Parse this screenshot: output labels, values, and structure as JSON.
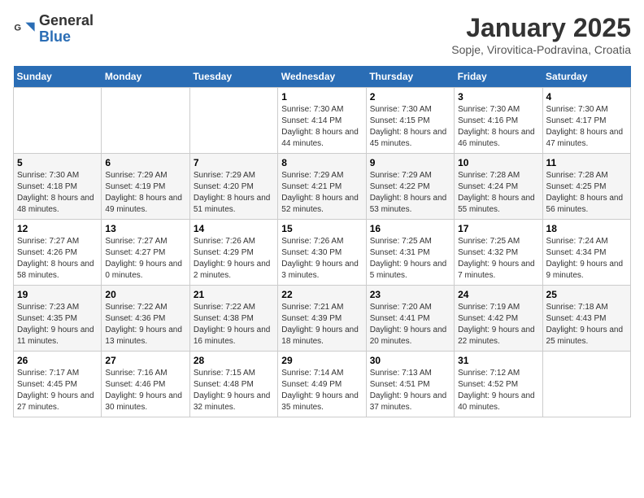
{
  "header": {
    "logo_general": "General",
    "logo_blue": "Blue",
    "title": "January 2025",
    "subtitle": "Sopje, Virovitica-Podravina, Croatia"
  },
  "days_of_week": [
    "Sunday",
    "Monday",
    "Tuesday",
    "Wednesday",
    "Thursday",
    "Friday",
    "Saturday"
  ],
  "weeks": [
    [
      {
        "day": "",
        "sunrise": "",
        "sunset": "",
        "daylight": ""
      },
      {
        "day": "",
        "sunrise": "",
        "sunset": "",
        "daylight": ""
      },
      {
        "day": "",
        "sunrise": "",
        "sunset": "",
        "daylight": ""
      },
      {
        "day": "1",
        "sunrise": "Sunrise: 7:30 AM",
        "sunset": "Sunset: 4:14 PM",
        "daylight": "Daylight: 8 hours and 44 minutes."
      },
      {
        "day": "2",
        "sunrise": "Sunrise: 7:30 AM",
        "sunset": "Sunset: 4:15 PM",
        "daylight": "Daylight: 8 hours and 45 minutes."
      },
      {
        "day": "3",
        "sunrise": "Sunrise: 7:30 AM",
        "sunset": "Sunset: 4:16 PM",
        "daylight": "Daylight: 8 hours and 46 minutes."
      },
      {
        "day": "4",
        "sunrise": "Sunrise: 7:30 AM",
        "sunset": "Sunset: 4:17 PM",
        "daylight": "Daylight: 8 hours and 47 minutes."
      }
    ],
    [
      {
        "day": "5",
        "sunrise": "Sunrise: 7:30 AM",
        "sunset": "Sunset: 4:18 PM",
        "daylight": "Daylight: 8 hours and 48 minutes."
      },
      {
        "day": "6",
        "sunrise": "Sunrise: 7:29 AM",
        "sunset": "Sunset: 4:19 PM",
        "daylight": "Daylight: 8 hours and 49 minutes."
      },
      {
        "day": "7",
        "sunrise": "Sunrise: 7:29 AM",
        "sunset": "Sunset: 4:20 PM",
        "daylight": "Daylight: 8 hours and 51 minutes."
      },
      {
        "day": "8",
        "sunrise": "Sunrise: 7:29 AM",
        "sunset": "Sunset: 4:21 PM",
        "daylight": "Daylight: 8 hours and 52 minutes."
      },
      {
        "day": "9",
        "sunrise": "Sunrise: 7:29 AM",
        "sunset": "Sunset: 4:22 PM",
        "daylight": "Daylight: 8 hours and 53 minutes."
      },
      {
        "day": "10",
        "sunrise": "Sunrise: 7:28 AM",
        "sunset": "Sunset: 4:24 PM",
        "daylight": "Daylight: 8 hours and 55 minutes."
      },
      {
        "day": "11",
        "sunrise": "Sunrise: 7:28 AM",
        "sunset": "Sunset: 4:25 PM",
        "daylight": "Daylight: 8 hours and 56 minutes."
      }
    ],
    [
      {
        "day": "12",
        "sunrise": "Sunrise: 7:27 AM",
        "sunset": "Sunset: 4:26 PM",
        "daylight": "Daylight: 8 hours and 58 minutes."
      },
      {
        "day": "13",
        "sunrise": "Sunrise: 7:27 AM",
        "sunset": "Sunset: 4:27 PM",
        "daylight": "Daylight: 9 hours and 0 minutes."
      },
      {
        "day": "14",
        "sunrise": "Sunrise: 7:26 AM",
        "sunset": "Sunset: 4:29 PM",
        "daylight": "Daylight: 9 hours and 2 minutes."
      },
      {
        "day": "15",
        "sunrise": "Sunrise: 7:26 AM",
        "sunset": "Sunset: 4:30 PM",
        "daylight": "Daylight: 9 hours and 3 minutes."
      },
      {
        "day": "16",
        "sunrise": "Sunrise: 7:25 AM",
        "sunset": "Sunset: 4:31 PM",
        "daylight": "Daylight: 9 hours and 5 minutes."
      },
      {
        "day": "17",
        "sunrise": "Sunrise: 7:25 AM",
        "sunset": "Sunset: 4:32 PM",
        "daylight": "Daylight: 9 hours and 7 minutes."
      },
      {
        "day": "18",
        "sunrise": "Sunrise: 7:24 AM",
        "sunset": "Sunset: 4:34 PM",
        "daylight": "Daylight: 9 hours and 9 minutes."
      }
    ],
    [
      {
        "day": "19",
        "sunrise": "Sunrise: 7:23 AM",
        "sunset": "Sunset: 4:35 PM",
        "daylight": "Daylight: 9 hours and 11 minutes."
      },
      {
        "day": "20",
        "sunrise": "Sunrise: 7:22 AM",
        "sunset": "Sunset: 4:36 PM",
        "daylight": "Daylight: 9 hours and 13 minutes."
      },
      {
        "day": "21",
        "sunrise": "Sunrise: 7:22 AM",
        "sunset": "Sunset: 4:38 PM",
        "daylight": "Daylight: 9 hours and 16 minutes."
      },
      {
        "day": "22",
        "sunrise": "Sunrise: 7:21 AM",
        "sunset": "Sunset: 4:39 PM",
        "daylight": "Daylight: 9 hours and 18 minutes."
      },
      {
        "day": "23",
        "sunrise": "Sunrise: 7:20 AM",
        "sunset": "Sunset: 4:41 PM",
        "daylight": "Daylight: 9 hours and 20 minutes."
      },
      {
        "day": "24",
        "sunrise": "Sunrise: 7:19 AM",
        "sunset": "Sunset: 4:42 PM",
        "daylight": "Daylight: 9 hours and 22 minutes."
      },
      {
        "day": "25",
        "sunrise": "Sunrise: 7:18 AM",
        "sunset": "Sunset: 4:43 PM",
        "daylight": "Daylight: 9 hours and 25 minutes."
      }
    ],
    [
      {
        "day": "26",
        "sunrise": "Sunrise: 7:17 AM",
        "sunset": "Sunset: 4:45 PM",
        "daylight": "Daylight: 9 hours and 27 minutes."
      },
      {
        "day": "27",
        "sunrise": "Sunrise: 7:16 AM",
        "sunset": "Sunset: 4:46 PM",
        "daylight": "Daylight: 9 hours and 30 minutes."
      },
      {
        "day": "28",
        "sunrise": "Sunrise: 7:15 AM",
        "sunset": "Sunset: 4:48 PM",
        "daylight": "Daylight: 9 hours and 32 minutes."
      },
      {
        "day": "29",
        "sunrise": "Sunrise: 7:14 AM",
        "sunset": "Sunset: 4:49 PM",
        "daylight": "Daylight: 9 hours and 35 minutes."
      },
      {
        "day": "30",
        "sunrise": "Sunrise: 7:13 AM",
        "sunset": "Sunset: 4:51 PM",
        "daylight": "Daylight: 9 hours and 37 minutes."
      },
      {
        "day": "31",
        "sunrise": "Sunrise: 7:12 AM",
        "sunset": "Sunset: 4:52 PM",
        "daylight": "Daylight: 9 hours and 40 minutes."
      },
      {
        "day": "",
        "sunrise": "",
        "sunset": "",
        "daylight": ""
      }
    ]
  ]
}
